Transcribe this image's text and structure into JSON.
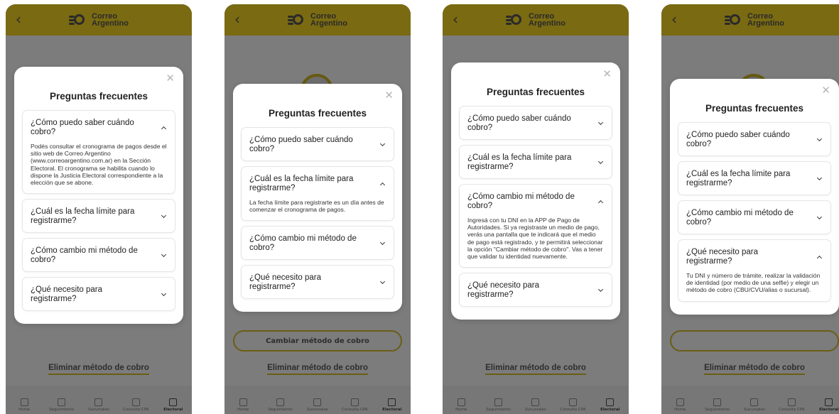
{
  "app": {
    "logo_line1": "Correo",
    "logo_line2": "Argentino",
    "back_symbol": "‹",
    "bg_button": "Cambiar método de cobro",
    "bg_link": "Eliminar método de cobro",
    "tabs": [
      "Home",
      "Seguimiento",
      "Sucursales",
      "Consulta CPA",
      "Electoral"
    ],
    "active_tab": "Electoral"
  },
  "colors": {
    "header": "#7a6a12",
    "overlay": "#7c7c7c",
    "accent": "#f2cf00"
  },
  "modal": {
    "title": "Preguntas frecuentes",
    "close_symbol": "✕",
    "faqs": [
      {
        "question": "¿Cómo puedo saber cuándo cobro?",
        "answer": "Podés consultar el cronograma de pagos desde el sitio web de Correo Argentino (www.correoargentino.com.ar) en la Sección Electoral. El cronograma se habilita cuando lo dispone la Justicia Electoral correspondiente a la elección que se abone."
      },
      {
        "question": "¿Cuál es la fecha límite para registrarme?",
        "answer": "La fecha límite para registrarte es un día antes de comenzar el cronograma de pagos."
      },
      {
        "question": "¿Cómo cambio mi método de cobro?",
        "answer": "Ingresá con tu DNI en la APP de Pago de Autoridades. Si ya registraste un medio de pago, verás una pantalla que te indicará que el medio de pago está registrado, y te permitirá seleccionar la opción \"Cambiar método de cobro\". Vas a tener que validar tu identidad nuevamente."
      },
      {
        "question": "¿Qué necesito para registrarme?",
        "answer": "Tu DNI y número de trámite, realizar la validación de identidad (por medio de una selfie) y elegir un método de cobro (CBU/CVU/alias o sucursal)."
      }
    ]
  },
  "screens": [
    {
      "open_index": 0
    },
    {
      "open_index": 1
    },
    {
      "open_index": 2
    },
    {
      "open_index": 3
    }
  ]
}
